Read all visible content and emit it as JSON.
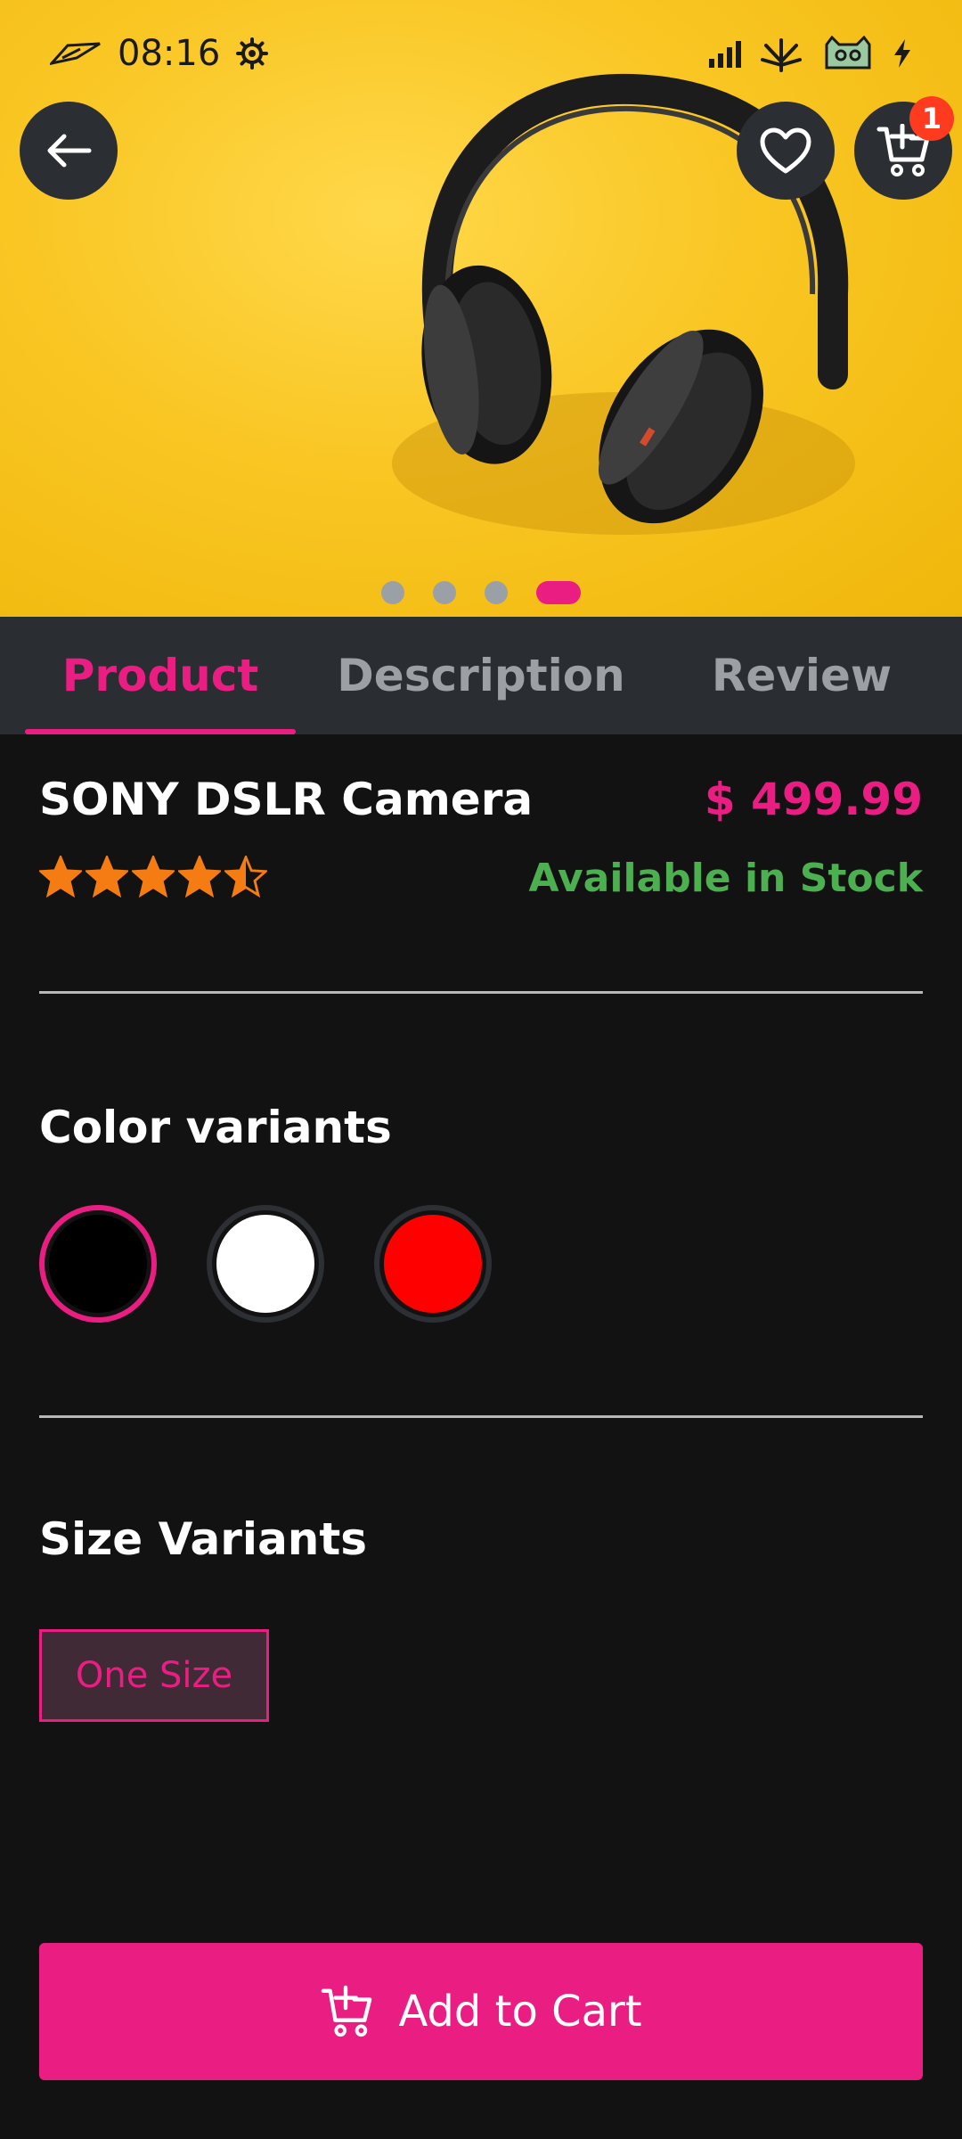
{
  "status_bar": {
    "time": "08:16"
  },
  "header": {
    "cart_count": "1"
  },
  "carousel": {
    "total": 4,
    "active_index": 3
  },
  "tabs": [
    {
      "label": "Product",
      "active": true
    },
    {
      "label": "Description",
      "active": false
    },
    {
      "label": "Review",
      "active": false
    }
  ],
  "product": {
    "title": "SONY DSLR Camera",
    "price": "$ 499.99",
    "rating": 4.5,
    "stock": "Available in Stock"
  },
  "colors": {
    "title": "Color variants",
    "options": [
      {
        "hex": "#000000",
        "selected": true
      },
      {
        "hex": "#ffffff",
        "selected": false
      },
      {
        "hex": "#ff0000",
        "selected": false
      }
    ]
  },
  "sizes": {
    "title": "Size Variants",
    "options": [
      "One Size"
    ]
  },
  "cta": {
    "label": "Add to Cart"
  },
  "theme": {
    "accent": "#ea1e82",
    "stock_color": "#4caf50",
    "star_color": "#f57c12"
  }
}
